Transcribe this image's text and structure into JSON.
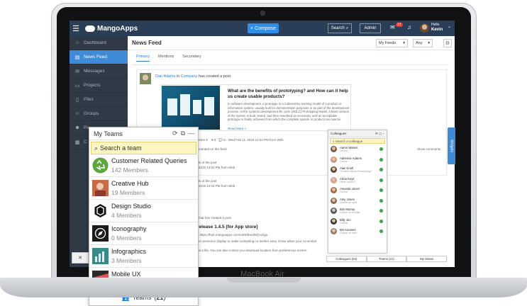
{
  "device": {
    "brand": "MacBook Air"
  },
  "topbar": {
    "logo": "MangoApps",
    "compose_label": "+ Compose",
    "search_label": "Search",
    "admin_label": "Admin",
    "notification_badge": "12",
    "greeting": "Hello",
    "user_name": "Kevin"
  },
  "sidebar": {
    "items": [
      {
        "label": "Dashboard",
        "icon": "home-icon"
      },
      {
        "label": "News Feed",
        "icon": "newspaper-icon"
      },
      {
        "label": "Messages",
        "icon": "mail-icon"
      },
      {
        "label": "Projects",
        "icon": "folder-icon"
      },
      {
        "label": "Files",
        "icon": "file-icon"
      },
      {
        "label": "Groups",
        "icon": "group-icon"
      },
      {
        "label": "Pe",
        "icon": "people-icon"
      },
      {
        "label": "C",
        "icon": "calendar-icon"
      }
    ]
  },
  "main": {
    "title": "News Feed",
    "feed_filter": "My Feeds",
    "any_filter": "Any",
    "tabs": [
      "Primary",
      "Mentions",
      "Secondary"
    ],
    "post": {
      "author": "Dan Adams",
      "in_word": "in",
      "target": "Company",
      "action": "has created a post",
      "headline": "What are the benefits of prototyping? and How can it help us create usable products?",
      "body": "In software development, a prototype is a rudimentary working model of a product or information system, usually built for demonstration purposes or as part of the development process. In the systems development life cycle (SDLC) Prototyping Model, a basic version of the system is built, tested, and then reworked as necessary until an acceptable prototype is finally achieved from which the complete system or product can now be",
      "read_more": "Read More »",
      "more_label": "More ▾",
      "stats": "♥ 5 · 💬 5 · Wed Feb 11, 2015 14:04 PM from Web",
      "commented_label": "mented on this feed",
      "show_comments": "Show comments",
      "comment1_a": "ls of the post",
      "comment1_b": "2015 14:04 PM from Web",
      "comment2_a": "ls of the post",
      "comment2_b": "2015 14:04 PM from Web"
    },
    "post2": {
      "line": "Chat has created a post",
      "headline": "release 1.4.5 [for App store]",
      "link": "s https://hub.mangoapps.com/mlnk/feed/MjYxOgx",
      "body1": "ker presence display to make contacting co-worker easy. Know when your co-worker",
      "body2": "ad a file. You can also control you download location from preferences screen."
    }
  },
  "colleagues": {
    "title": "Colleagues",
    "search_placeholder": "Search a colleague",
    "people": [
      {
        "name": "Aaron Waters",
        "status": "Online"
      },
      {
        "name": "Adrienne Adams",
        "status": "Online"
      },
      {
        "name": "Alan Knoll",
        "status": "\"Excited about Everything!\""
      },
      {
        "name": "Alicia Keys",
        "status": "Hello world!!!"
      },
      {
        "name": "Amanda Jones",
        "status": "Online"
      },
      {
        "name": "Amy Jones",
        "status": "Online on web"
      },
      {
        "name": "Bim Murray",
        "status": "Online on mobile"
      },
      {
        "name": "Billy Jon",
        "status": "Online"
      },
      {
        "name": "Bin Koomes",
        "status": "Online on web"
      }
    ],
    "tab_colleagues": "Colleagues (54)",
    "tab_teams": "Teams (21)",
    "tab_status": "My Status"
  },
  "widgets_label": "Widgets",
  "teams": {
    "title": "My Teams",
    "search_placeholder": "Search a team",
    "items": [
      {
        "name": "Customer Related Queries",
        "count": "142 Members",
        "icon": "recycle-icon",
        "color": "#5aa83a"
      },
      {
        "name": "Creative Hub",
        "count": "19 Members",
        "icon": "photo-icon",
        "color": "#c86a4a"
      },
      {
        "name": "Design Studio",
        "count": "4 Members",
        "icon": "cube-logo-icon",
        "color": "#111111"
      },
      {
        "name": "Iconography",
        "count": "0 Members",
        "icon": "compass-icon",
        "color": "#1a1a1a"
      },
      {
        "name": "Infographics",
        "count": "3 Members",
        "icon": "chart-photo-icon",
        "color": "#3a8a8a"
      },
      {
        "name": "Mobile UX",
        "count": "4 Members",
        "icon": "ux-icon",
        "color": "#e8505a"
      }
    ],
    "footer_label": "Teams",
    "footer_count": "21"
  }
}
